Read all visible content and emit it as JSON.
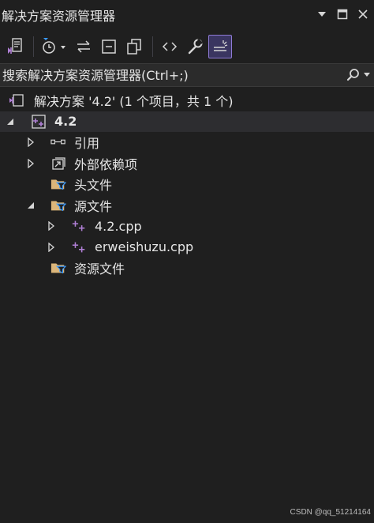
{
  "window": {
    "title": "解决方案资源管理器"
  },
  "search": {
    "placeholder": "搜索解决方案资源管理器(Ctrl+;)"
  },
  "tree": {
    "solution_label": "解决方案 '4.2' (1 个项目，共 1 个)",
    "project_label": "4.2",
    "references_label": "引用",
    "external_deps_label": "外部依赖项",
    "header_files_label": "头文件",
    "source_files_label": "源文件",
    "file1_label": "4.2.cpp",
    "file2_label": "erweishuzu.cpp",
    "resource_files_label": "资源文件"
  },
  "watermark": "CSDN @qq_51214164",
  "colors": {
    "background": "#1f1f1f",
    "accent_purple": "#b180d7",
    "folder_yellow": "#dcb67a",
    "selection": "#2d2d30",
    "active_border": "#8f7bd6"
  }
}
